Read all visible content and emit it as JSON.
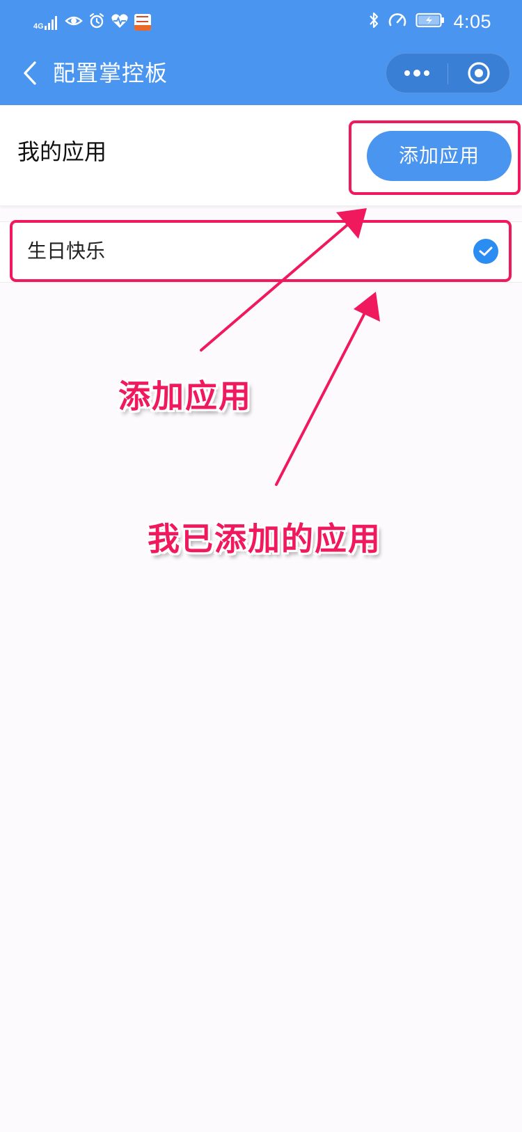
{
  "status_bar": {
    "network": "4G",
    "time": "4:05",
    "icons": [
      "signal-icon",
      "eye-icon",
      "alarm-icon",
      "heart-monitor-icon",
      "app-thumbnail-icon",
      "bluetooth-icon",
      "speedometer-icon",
      "battery-charging-icon"
    ]
  },
  "nav": {
    "back_icon": "chevron-left-icon",
    "title": "配置掌控板",
    "more_icon": "more-dots-icon",
    "target_icon": "target-icon"
  },
  "section": {
    "title": "我的应用",
    "add_button_label": "添加应用"
  },
  "apps": [
    {
      "name": "生日快乐",
      "selected": true
    }
  ],
  "colors": {
    "primary": "#4a95f0",
    "capsule": "#3a7fd6",
    "check": "#2b8cf1",
    "annotation": "#f0195d",
    "background": "#fdfafd"
  },
  "annotations": {
    "add_app_label": "添加应用",
    "added_apps_label": "我已添加的应用"
  }
}
